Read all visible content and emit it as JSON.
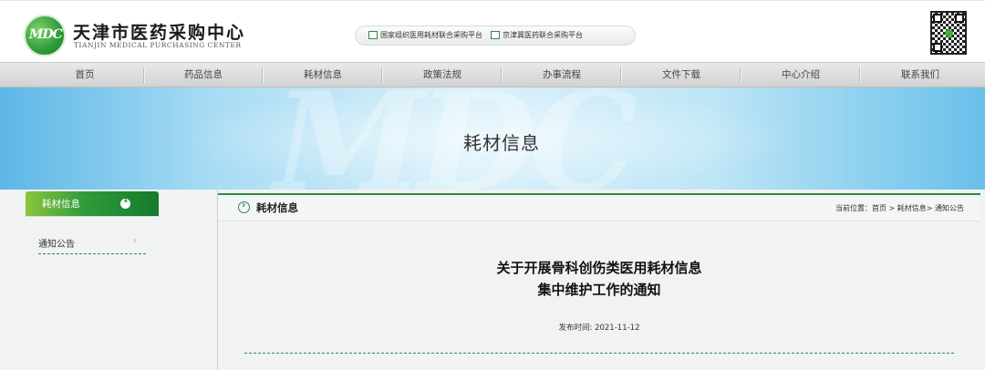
{
  "header": {
    "logo_mark": "MDC",
    "logo_cn": "天津市医药采购中心",
    "logo_en": "TIANJIN MEDICAL PURCHASING CENTER",
    "platforms": [
      "国家组织医用耗材联合采购平台",
      "京津冀医药联合采购平台"
    ],
    "colors": {
      "brand_green": "#2c8a44"
    }
  },
  "nav": {
    "items": [
      "首页",
      "药品信息",
      "耗材信息",
      "政策法规",
      "办事流程",
      "文件下载",
      "中心介绍",
      "联系我们"
    ]
  },
  "banner": {
    "title": "耗材信息",
    "watermark": "MDC"
  },
  "sidebar": {
    "heading": "耗材信息",
    "items": [
      {
        "label": "通知公告"
      }
    ]
  },
  "content": {
    "heading": "耗材信息",
    "breadcrumb": "当前位置：首页 > 耗材信息> 通知公告",
    "article_title_line1": "关于开展骨科创伤类医用耗材信息",
    "article_title_line2": "集中维护工作的通知",
    "publish_time": "发布时间: 2021-11-12"
  }
}
